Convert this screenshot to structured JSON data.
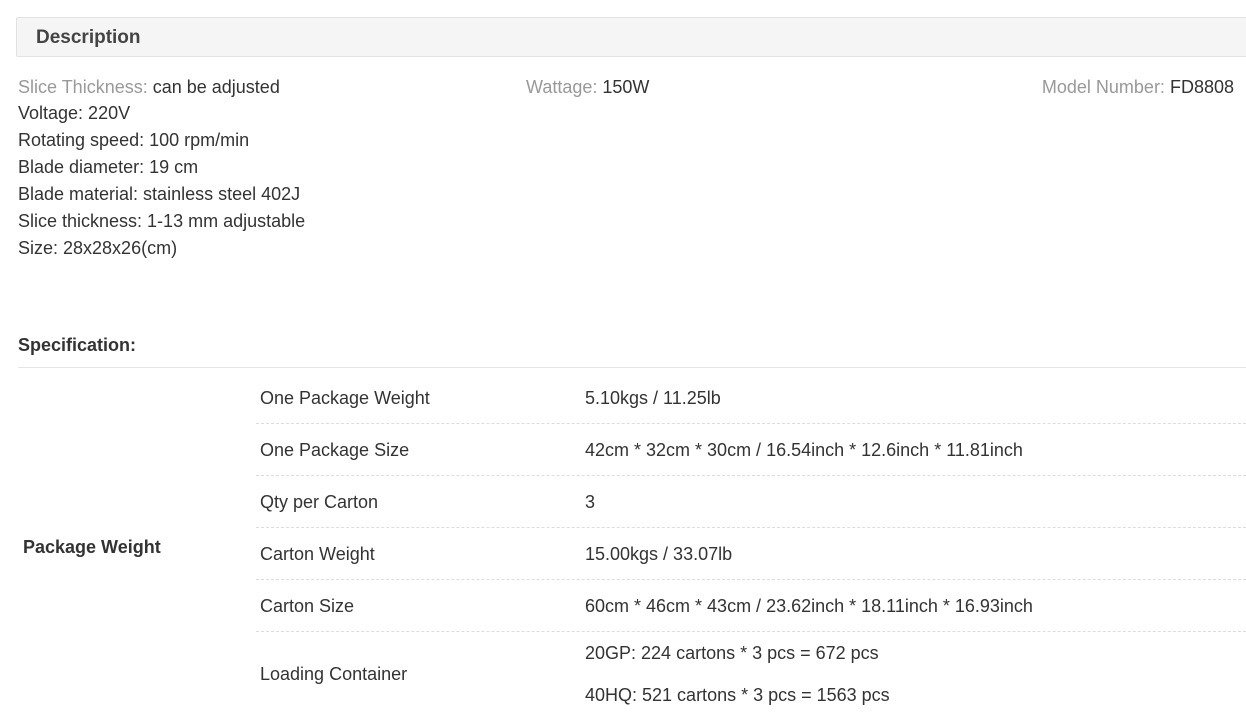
{
  "description": {
    "title": "Description",
    "attributes": [
      {
        "label": "Slice Thickness:",
        "value": "can be adjusted"
      },
      {
        "label": "Wattage:",
        "value": "150W"
      },
      {
        "label": "Model Number:",
        "value": "FD8808"
      }
    ],
    "details": [
      "Voltage: 220V",
      "Rotating speed: 100 rpm/min",
      "Blade diameter: 19 cm",
      "Blade material: stainless steel 402J",
      "Slice thickness: 1-13 mm adjustable",
      "Size: 28x28x26(cm)"
    ]
  },
  "specification": {
    "title": "Specification:",
    "group_label": "Package Weight",
    "rows": [
      {
        "key": "One Package Weight",
        "value": "5.10kgs / 11.25lb"
      },
      {
        "key": "One Package Size",
        "value": "42cm * 32cm * 30cm / 16.54inch * 12.6inch * 11.81inch"
      },
      {
        "key": "Qty per Carton",
        "value": "3"
      },
      {
        "key": "Carton Weight",
        "value": "15.00kgs / 33.07lb"
      },
      {
        "key": "Carton Size",
        "value": "60cm * 46cm * 43cm / 23.62inch * 18.11inch * 16.93inch"
      }
    ],
    "loading": {
      "key": "Loading Container",
      "values": [
        "20GP: 224 cartons * 3 pcs = 672 pcs",
        "40HQ: 521 cartons * 3 pcs = 1563 pcs"
      ]
    }
  }
}
